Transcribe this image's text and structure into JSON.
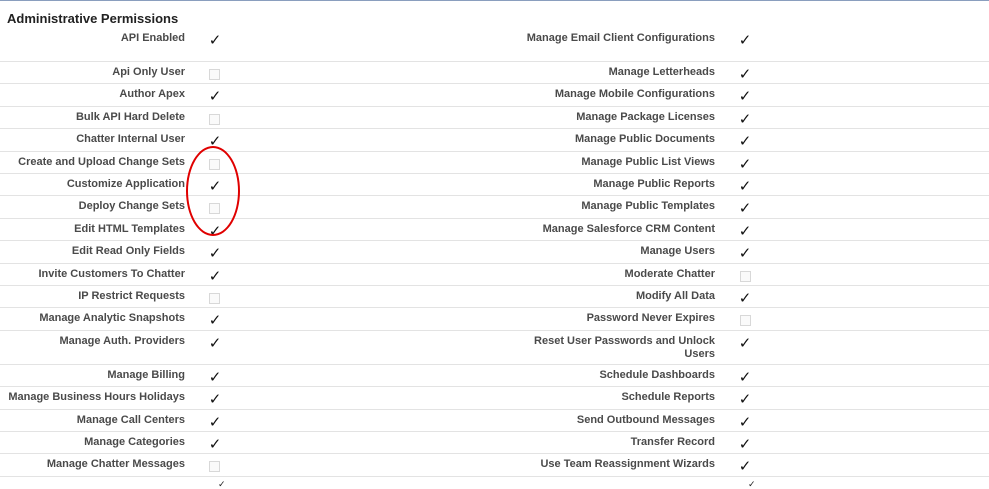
{
  "section": {
    "title": "Administrative Permissions"
  },
  "rows": [
    {
      "left": {
        "label": "API Enabled",
        "checked": true
      },
      "right": {
        "label": "Manage Email Client Configurations",
        "checked": true
      },
      "tall": true
    },
    {
      "left": {
        "label": "Api Only User",
        "checked": false
      },
      "right": {
        "label": "Manage Letterheads",
        "checked": true
      }
    },
    {
      "left": {
        "label": "Author Apex",
        "checked": true
      },
      "right": {
        "label": "Manage Mobile Configurations",
        "checked": true
      }
    },
    {
      "left": {
        "label": "Bulk API Hard Delete",
        "checked": false
      },
      "right": {
        "label": "Manage Package Licenses",
        "checked": true
      }
    },
    {
      "left": {
        "label": "Chatter Internal User",
        "checked": true
      },
      "right": {
        "label": "Manage Public Documents",
        "checked": true
      }
    },
    {
      "left": {
        "label": "Create and Upload Change Sets",
        "checked": false
      },
      "right": {
        "label": "Manage Public List Views",
        "checked": true
      }
    },
    {
      "left": {
        "label": "Customize Application",
        "checked": true
      },
      "right": {
        "label": "Manage Public Reports",
        "checked": true
      }
    },
    {
      "left": {
        "label": "Deploy Change Sets",
        "checked": false
      },
      "right": {
        "label": "Manage Public Templates",
        "checked": true
      }
    },
    {
      "left": {
        "label": "Edit HTML Templates",
        "checked": true
      },
      "right": {
        "label": "Manage Salesforce CRM Content",
        "checked": true
      }
    },
    {
      "left": {
        "label": "Edit Read Only Fields",
        "checked": true
      },
      "right": {
        "label": "Manage Users",
        "checked": true
      }
    },
    {
      "left": {
        "label": "Invite Customers To Chatter",
        "checked": true
      },
      "right": {
        "label": "Moderate Chatter",
        "checked": false
      }
    },
    {
      "left": {
        "label": "IP Restrict Requests",
        "checked": false
      },
      "right": {
        "label": "Modify All Data",
        "checked": true
      }
    },
    {
      "left": {
        "label": "Manage Analytic Snapshots",
        "checked": true
      },
      "right": {
        "label": "Password Never Expires",
        "checked": false
      }
    },
    {
      "left": {
        "label": "Manage Auth. Providers",
        "checked": true
      },
      "right": {
        "label": "Reset User Passwords and Unlock Users",
        "checked": true
      },
      "tall": true
    },
    {
      "left": {
        "label": "Manage Billing",
        "checked": true
      },
      "right": {
        "label": "Schedule Dashboards",
        "checked": true
      }
    },
    {
      "left": {
        "label": "Manage Business Hours Holidays",
        "checked": true
      },
      "right": {
        "label": "Schedule Reports",
        "checked": true
      }
    },
    {
      "left": {
        "label": "Manage Call Centers",
        "checked": true
      },
      "right": {
        "label": "Send Outbound Messages",
        "checked": true
      }
    },
    {
      "left": {
        "label": "Manage Categories",
        "checked": true
      },
      "right": {
        "label": "Transfer Record",
        "checked": true
      }
    },
    {
      "left": {
        "label": "Manage Chatter Messages",
        "checked": false
      },
      "right": {
        "label": "Use Team Reassignment Wizards",
        "checked": true
      }
    }
  ],
  "icons": {
    "checked": "checkmark-icon",
    "unchecked": "empty-checkbox-icon"
  },
  "colors": {
    "annotation": "#e00000",
    "header_rule": "#8a9ebe",
    "row_rule": "#e3e3e3"
  }
}
